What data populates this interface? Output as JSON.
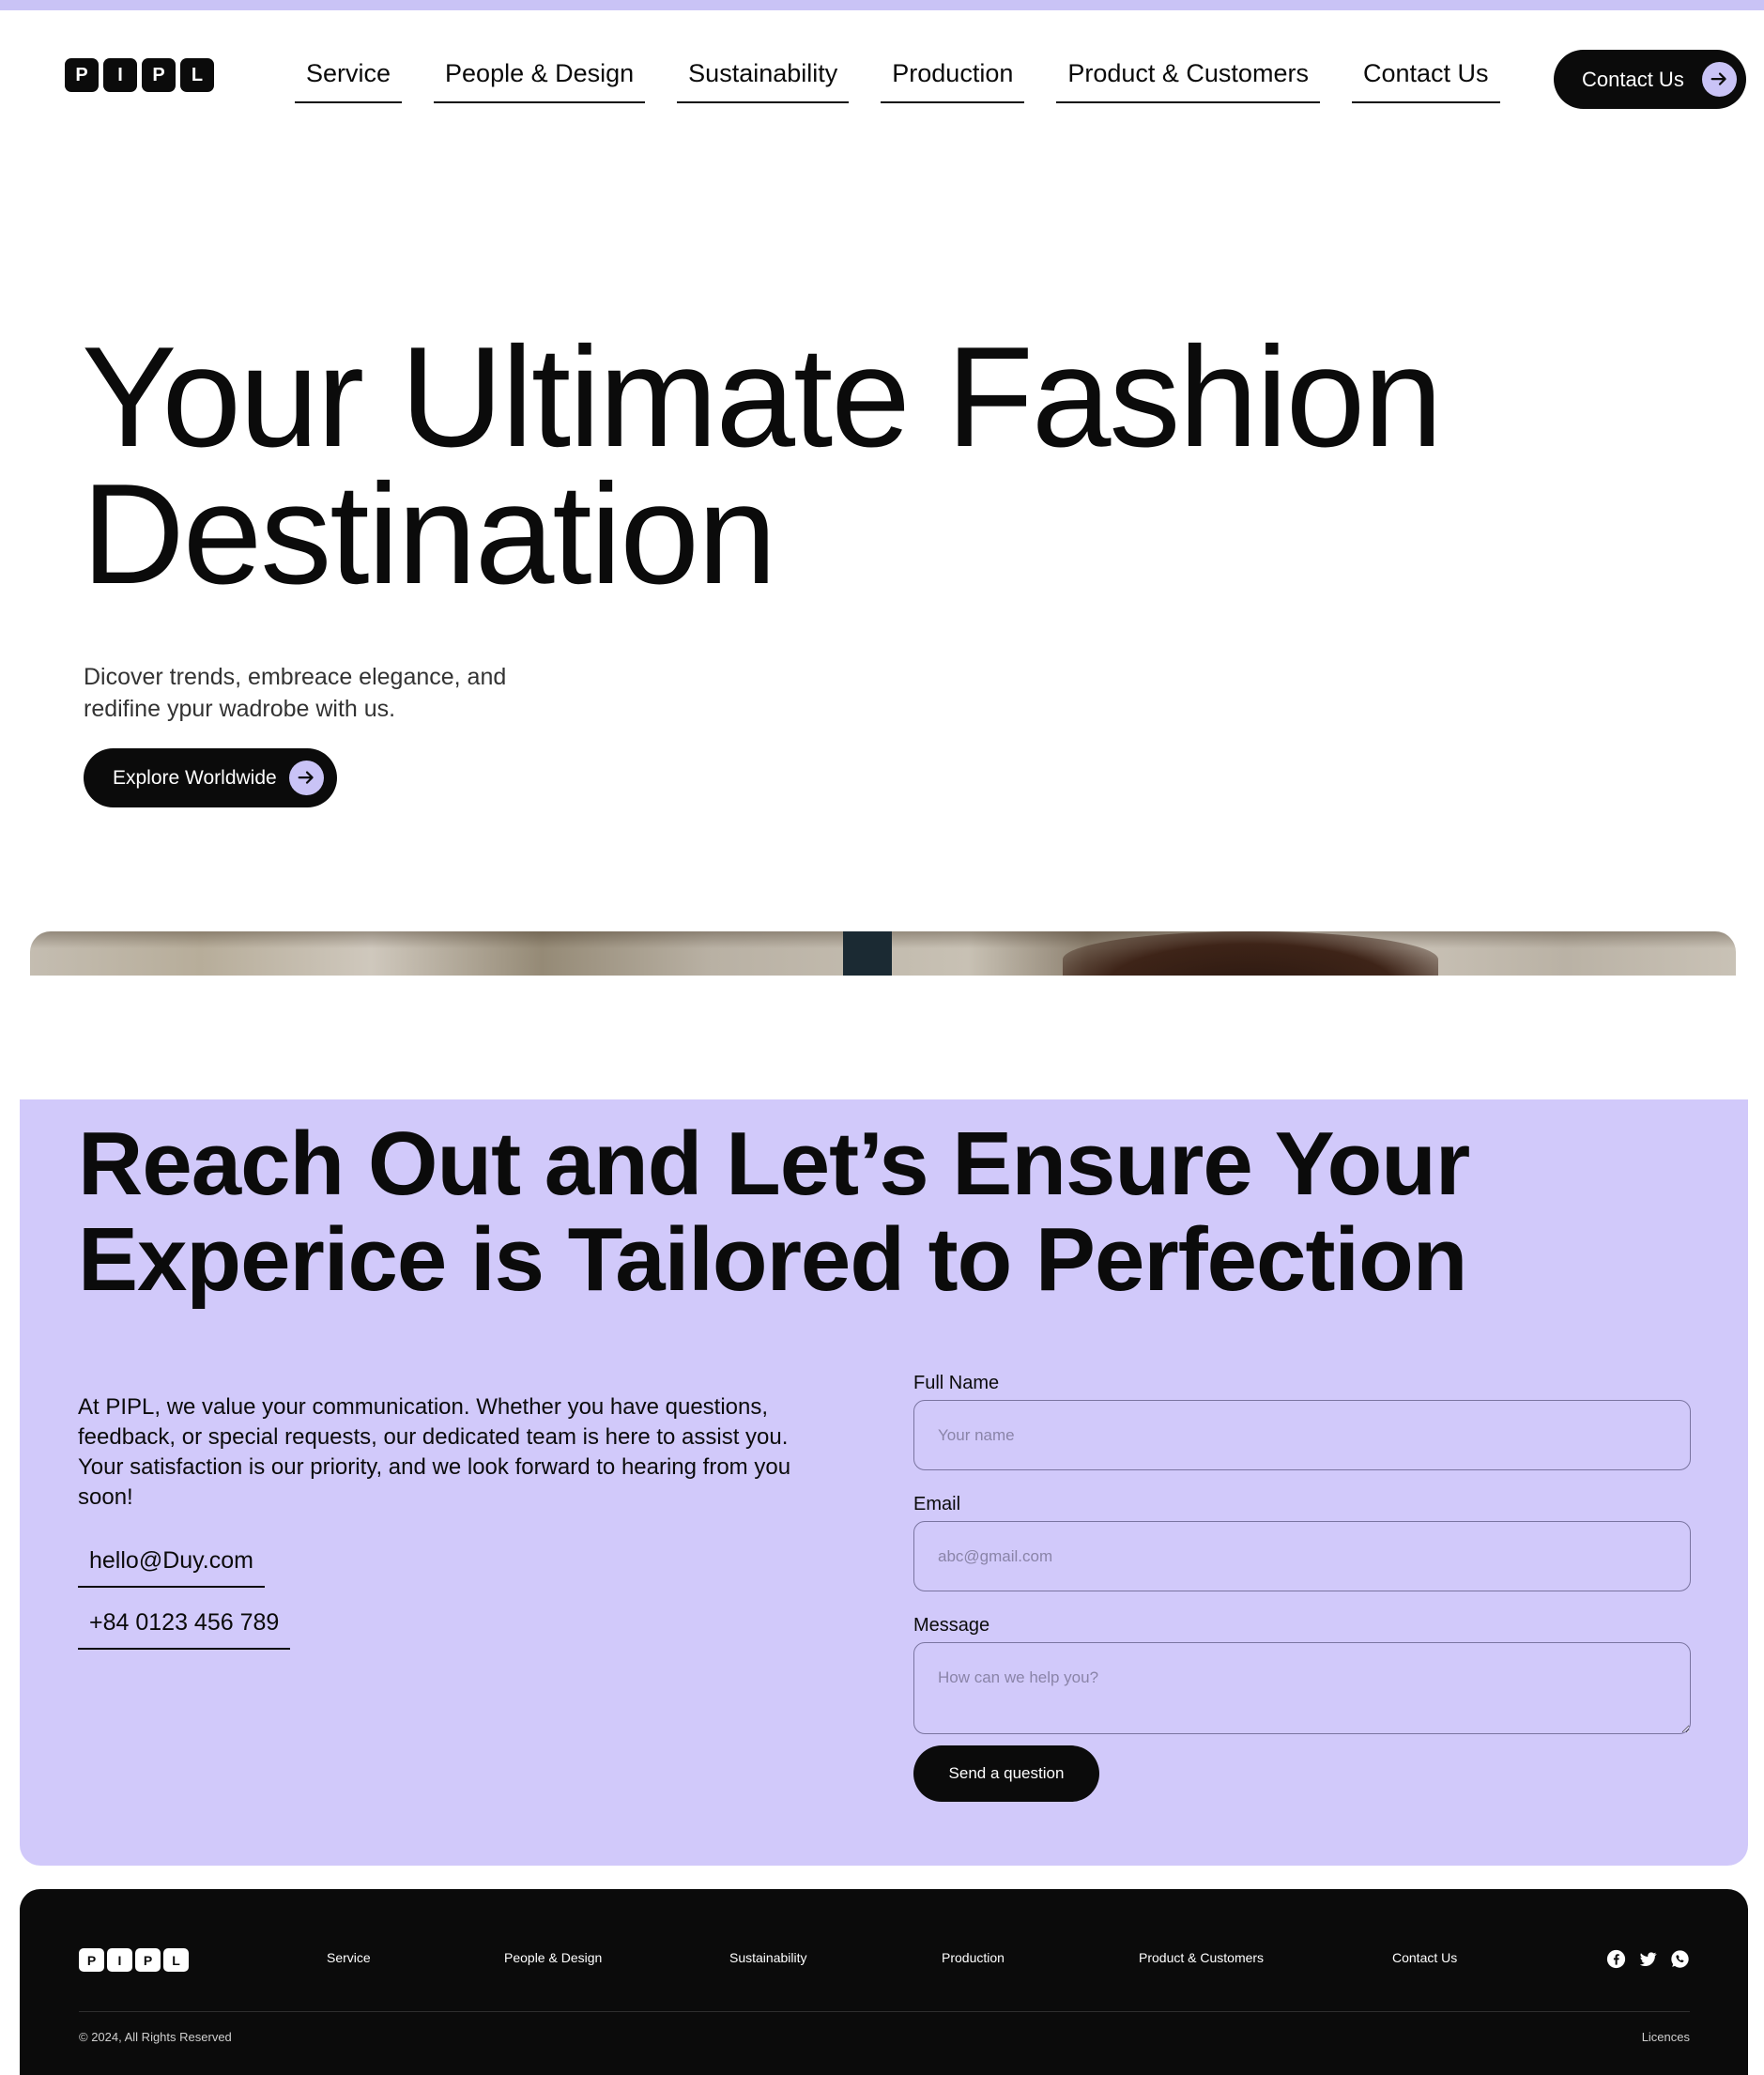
{
  "colors": {
    "accent": "#c9c3f6",
    "section_bg": "#d1c9fa",
    "dark": "#0b0b0b"
  },
  "header": {
    "logo_letters": [
      "P",
      "I",
      "P",
      "L"
    ],
    "nav": [
      "Service",
      "People & Design",
      "Sustainability",
      "Production",
      "Product & Customers",
      "Contact Us"
    ],
    "cta_label": "Contact Us",
    "cta_icon": "arrow-right-icon"
  },
  "hero": {
    "title_line1": "Your Ultimate Fashion",
    "title_line2": "Destination",
    "subtitle_line1": "Dicover trends, embreace elegance, and",
    "subtitle_line2": "redifine ypur wadrobe with us.",
    "button_label": "Explore Worldwide",
    "button_icon": "arrow-right-icon"
  },
  "contact": {
    "title_line1": "Reach Out and Let’s Ensure Your",
    "title_line2": "Experice is Tailored to Perfection",
    "text": "At PIPL, we value your communication. Whether you have questions, feedback, or special requests, our dedicated team is here to assist you. Your satisfaction is our priority, and we look forward to hearing from you soon!",
    "email": "hello@Duy.com",
    "phone": "+84 0123 456 789",
    "form": {
      "name_label": "Full Name",
      "name_placeholder": "Your name",
      "email_label": "Email",
      "email_placeholder": "abc@gmail.com",
      "message_label": "Message",
      "message_placeholder": "How can we help you?",
      "submit_label": "Send a question"
    }
  },
  "footer": {
    "logo_letters": [
      "P",
      "I",
      "P",
      "L"
    ],
    "nav": [
      "Service",
      "People & Design",
      "Sustainability",
      "Production",
      "Product & Customers",
      "Contact Us"
    ],
    "social_icons": [
      "facebook-icon",
      "twitter-icon",
      "whatsapp-icon"
    ],
    "copyright": "© 2024, All Rights Reserved",
    "licences": "Licences"
  }
}
